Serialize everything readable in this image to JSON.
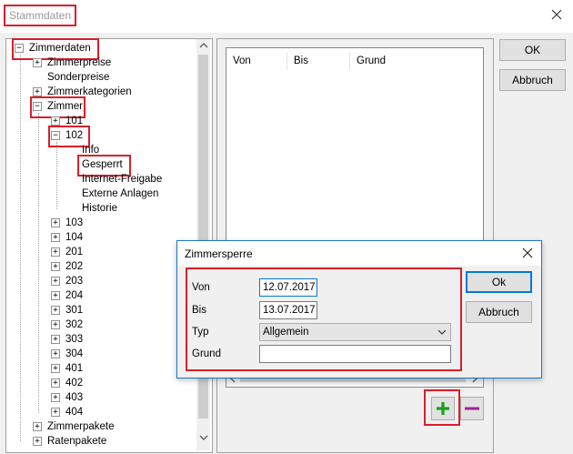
{
  "window": {
    "title": "Stammdaten",
    "close_icon": "close-icon"
  },
  "tree": {
    "root": "Zimmerdaten",
    "zimmerpreise": "Zimmerpreise",
    "sonderpreise": "Sonderpreise",
    "zimmerkategorien": "Zimmerkategorien",
    "zimmer": "Zimmer",
    "r101": "101",
    "r102": "102",
    "info": "Info",
    "gesperrt": "Gesperrt",
    "internet": "Internet-Freigabe",
    "externe": "Externe Anlagen",
    "historie": "Historie",
    "rooms": [
      "103",
      "104",
      "201",
      "202",
      "203",
      "204",
      "301",
      "302",
      "303",
      "304",
      "401",
      "402",
      "403",
      "404"
    ],
    "zimmerpakete": "Zimmerpakete",
    "ratenpakete": "Ratenpakete"
  },
  "list": {
    "columns": [
      "Von",
      "Bis",
      "Grund"
    ]
  },
  "buttons": {
    "ok": "OK",
    "abbruch": "Abbruch"
  },
  "dialog": {
    "title": "Zimmersperre",
    "von_label": "Von",
    "von_value": "12.07.2017",
    "bis_label": "Bis",
    "bis_value": "13.07.2017",
    "typ_label": "Typ",
    "typ_value": "Allgemein",
    "grund_label": "Grund",
    "grund_value": "",
    "ok": "Ok",
    "abbruch": "Abbruch"
  },
  "actions": {
    "add_icon": "plus-icon",
    "remove_icon": "minus-icon",
    "add_color": "#1b9e1b",
    "remove_color": "#a0209a"
  },
  "colors": {
    "highlight": "#d8202a",
    "focus_blue": "#0078d7"
  }
}
